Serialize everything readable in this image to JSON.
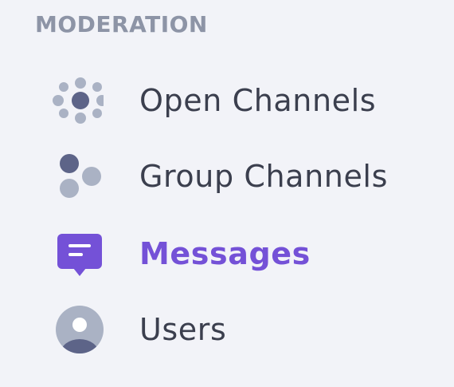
{
  "sidebar": {
    "section_title": "MODERATION",
    "items": [
      {
        "label": "Open Channels",
        "icon": "open-channels-icon",
        "active": false
      },
      {
        "label": "Group Channels",
        "icon": "group-channels-icon",
        "active": false
      },
      {
        "label": "Messages",
        "icon": "messages-icon",
        "active": true
      },
      {
        "label": "Users",
        "icon": "users-icon",
        "active": false
      }
    ]
  },
  "colors": {
    "background": "#f2f3f8",
    "section_title": "#8d94a6",
    "label": "#3b3f4e",
    "active": "#7451d7",
    "icon_dark": "#5d6488",
    "icon_light": "#aab2c4"
  }
}
